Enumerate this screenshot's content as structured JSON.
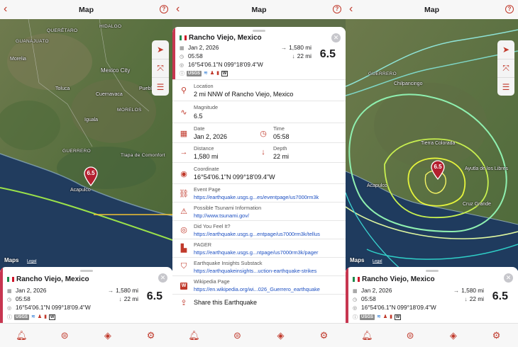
{
  "nav": {
    "title": "Map",
    "back_icon": "chevron-left-icon",
    "help_icon": "question-circle-icon",
    "help_glyph": "?"
  },
  "accent_color": "#c0392b",
  "event": {
    "flag": "Mexico",
    "place": "Rancho Viejo, Mexico",
    "date": "Jan 2, 2026",
    "time": "05:58",
    "coordinate": "16°54'06.1\"N 099°18'09.4\"W",
    "distance": "1,580 mi",
    "depth": "22 mi",
    "magnitude": "6.5",
    "source_badge": "USGS",
    "w_badge": "W"
  },
  "map1": {
    "labels": [
      "HIDALGO",
      "QUERÉTARO",
      "GUANAJUATO",
      "Morelia",
      "Mexico City",
      "Toluca",
      "Puebla",
      "Cuernavaca",
      "Iguala",
      "MORELOS",
      "GUERRERO",
      "Tlapa de Comonfort",
      "Acapulco"
    ],
    "apple_maps": "Maps",
    "legal": "Legal"
  },
  "map3": {
    "labels": [
      "GUERRERO",
      "Chilpancingo",
      "Tierra Colorada",
      "Acapulco",
      "Ayutla de los Libres",
      "Cruz Grande"
    ],
    "apple_maps": "Maps",
    "legal": "Legal"
  },
  "details": {
    "location_label": "Location",
    "location_value": "2 mi NNW of Rancho Viejo, Mexico",
    "magnitude_label": "Magnitude",
    "date_label": "Date",
    "time_label": "Time",
    "distance_label": "Distance",
    "depth_label": "Depth",
    "coordinate_label": "Coordinate",
    "event_page_label": "Event Page",
    "event_page_link": "https://earthquake.usgs.g...es/eventpage/us7000rm3k",
    "tsunami_label": "Possible Tsunami Information",
    "tsunami_link": "http://www.tsunami.gov/",
    "dyfi_label": "Did You Feel It?",
    "dyfi_link": "https://earthquake.usgs.g...entpage/us7000rm3k/tellus",
    "pager_label": "PAGER",
    "pager_link": "https://earthquake.usgs.g...ntpage/us7000rm3k/pager",
    "substack_label": "Earthquake Insights Substack",
    "substack_link": "https://earthquakeinsights...uction-earthquake-strikes",
    "wiki_label": "Wikipedia Page",
    "wiki_link": "https://en.wikipedia.org/wi...026_Guerrero_earthquake",
    "share_label": "Share this Earthquake"
  },
  "map_controls": [
    "location-arrow-icon",
    "fit-bounds-icon",
    "list-icon"
  ],
  "tabs": [
    "bell-icon",
    "feed-icon",
    "layers-icon",
    "gear-icon"
  ]
}
